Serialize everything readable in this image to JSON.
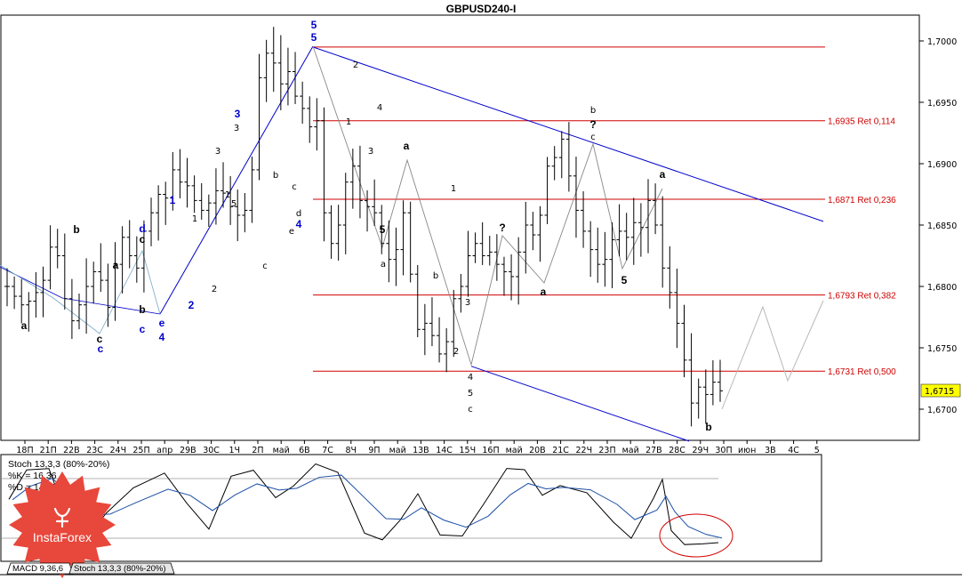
{
  "title": "GBPUSD240-I",
  "chart_data": [
    {
      "type": "candlestick",
      "title": "GBPUSD240-I",
      "ylim": [
        1.6675,
        1.7015
      ],
      "y_ticks": [
        "1,7000",
        "1,6950",
        "1,6900",
        "1,6850",
        "1,6800",
        "1,6750",
        "1,6700"
      ],
      "current_price": "1,6715",
      "x_ticks": [
        "18П",
        "21П",
        "22В",
        "23С",
        "24Ч",
        "25П",
        "апр",
        "29В",
        "30С",
        "1Ч",
        "2П",
        "май",
        "6В",
        "7С",
        "8Ч",
        "9П",
        "май",
        "13В",
        "14С",
        "15Ч",
        "16П",
        "май",
        "20В",
        "21С",
        "22Ч",
        "23П",
        "май",
        "27В",
        "28С",
        "29Ч",
        "30П",
        "июн",
        "3В",
        "4С",
        "5"
      ],
      "close_path": [
        1.68,
        1.6792,
        1.6785,
        1.6788,
        1.6795,
        1.6805,
        1.6832,
        1.6825,
        1.679,
        1.6772,
        1.6785,
        1.68,
        1.6812,
        1.6805,
        1.6783,
        1.6818,
        1.684,
        1.6825,
        1.6815,
        1.6845,
        1.686,
        1.6875,
        1.6872,
        1.6895,
        1.6885,
        1.6882,
        1.687,
        1.6862,
        1.6868,
        1.6878,
        1.6876,
        1.6865,
        1.6858,
        1.6862,
        1.6895,
        1.697,
        1.699,
        1.6982,
        1.6965,
        1.6975,
        1.6955,
        1.6945,
        1.693,
        1.6935,
        1.686,
        1.6835,
        1.685,
        1.6885,
        1.6898,
        1.687,
        1.6865,
        1.686,
        1.6835,
        1.6822,
        1.683,
        1.686,
        1.681,
        1.6765,
        1.677,
        1.676,
        1.6745,
        1.6755,
        1.679,
        1.68,
        1.6825,
        1.6835,
        1.6825,
        1.6828,
        1.6818,
        1.6812,
        1.6808,
        1.6828,
        1.685,
        1.6842,
        1.6858,
        1.6898,
        1.6905,
        1.692,
        1.689,
        1.6862,
        1.6845,
        1.683,
        1.6818,
        1.6822,
        1.6838,
        1.6845,
        1.684,
        1.6852,
        1.6848,
        1.687,
        1.685,
        1.6815,
        1.6795,
        1.677,
        1.674,
        1.6705,
        1.6718,
        1.6712,
        1.6722,
        1.6715
      ],
      "horizontal_levels": [
        {
          "price": 1.6995,
          "label": ""
        },
        {
          "price": 1.6935,
          "label": "1,6935 Ret 0,114"
        },
        {
          "price": 1.6871,
          "label": "1,6871 Ret 0,236"
        },
        {
          "price": 1.6793,
          "label": "1,6793 Ret 0,382"
        },
        {
          "price": 1.6731,
          "label": "1,6731 Ret 0,500"
        }
      ],
      "wave_labels_blue": [
        "5",
        "5",
        "3",
        "1",
        "2",
        "d",
        "e",
        "4",
        "c",
        "c",
        "4"
      ],
      "wave_labels_black": [
        "a",
        "b",
        "c",
        "a",
        "b",
        "c",
        "1",
        "2",
        "3",
        "1",
        "3",
        "5",
        "b",
        "c",
        "d",
        "e",
        "2",
        "1",
        "3",
        "4",
        "5",
        "a",
        "a",
        "b",
        "1",
        "2",
        "3",
        "4",
        "5",
        "c",
        "?",
        "a",
        "b",
        "?",
        "c",
        "5",
        "a",
        "b",
        "c"
      ]
    },
    {
      "type": "line",
      "title": "Stoch 13,3,3 (80%-20%)",
      "series": [
        {
          "name": "%K",
          "last": "16,36"
        },
        {
          "name": "%D",
          "last": "14,45"
        }
      ],
      "ylim": [
        0,
        100
      ],
      "levels": [
        80,
        20
      ]
    }
  ],
  "indicator": {
    "name": "Stoch 13,3,3 (80%-20%)",
    "k_label": "%K = 16,36",
    "d_label": "%D = 14,45"
  },
  "tabs": [
    {
      "label": "MACD 9,36,6"
    },
    {
      "label": "Stoch 13,3,3 (80%-20%)"
    }
  ],
  "logo": {
    "text": "InstaForex",
    "color": "#e8473b"
  },
  "colors": {
    "level": "#d00000",
    "channel": "#0000cc",
    "wave_blue": "#0000cc",
    "forecast": "#b8b8b8",
    "highlight_circle": "#d00000"
  }
}
